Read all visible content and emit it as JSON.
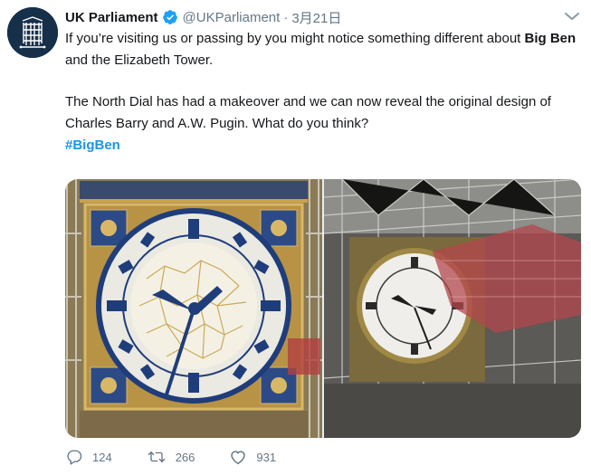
{
  "tweet": {
    "author_name": "UK Parliament",
    "handle": "@UKParliament",
    "separator": "·",
    "date": "3月21日",
    "text": {
      "p1_pre": "If you’re visiting us or passing by you might notice something different about ",
      "p1_bold": "Big Ben",
      "p1_post": " and the Elizabeth Tower.",
      "p2": "The North Dial has had a makeover and we can now reveal the original design of Charles Barry and A.W. Pugin. What do you think?",
      "hashtag": "#BigBen"
    },
    "stats": {
      "replies": "124",
      "retweets": "266",
      "likes": "931"
    }
  },
  "icons": {
    "avatar": "portcullis-icon",
    "verified": "verified-badge-icon",
    "menu": "chevron-down-icon",
    "reply": "reply-icon",
    "retweet": "retweet-icon",
    "like": "heart-icon"
  },
  "colors": {
    "link": "#1b95e0",
    "verified": "#1da1f2",
    "muted": "#657786",
    "avatar_bg": "#17304a"
  }
}
